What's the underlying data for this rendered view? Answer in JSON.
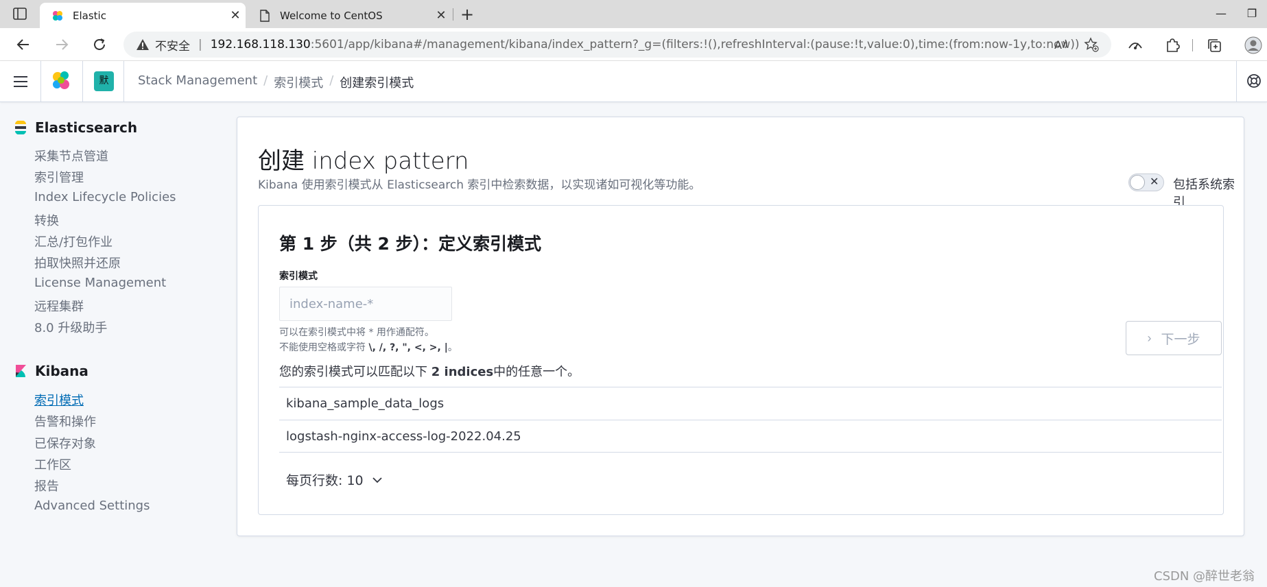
{
  "browser": {
    "tabs": [
      {
        "title": "Elastic",
        "active": true
      },
      {
        "title": "Welcome to CentOS",
        "active": false
      }
    ],
    "tab_close": "✕",
    "new_tab": "+",
    "window": {
      "minimize": "—",
      "maximize": "❐"
    },
    "address": {
      "security_label": "不安全",
      "host": "192.168.118.130",
      "path": ":5601/app/kibana#/management/kibana/index_pattern?_g=(filters:!(),refreshInterval:(pause:!t,value:0),time:(from:now-1y,to:now))"
    }
  },
  "header": {
    "space_badge": "默",
    "breadcrumbs": [
      "Stack Management",
      "索引模式",
      "创建索引模式"
    ]
  },
  "sidenav": {
    "elasticsearch": {
      "title": "Elasticsearch",
      "items": [
        "采集节点管道",
        "索引管理",
        "Index Lifecycle Policies",
        "转换",
        "汇总/打包作业",
        "拍取快照并还原",
        "License Management",
        "远程集群",
        "8.0 升级助手"
      ]
    },
    "kibana": {
      "title": "Kibana",
      "items": [
        "索引模式",
        "告警和操作",
        "已保存对象",
        "工作区",
        "报告",
        "Advanced Settings"
      ],
      "active_index": 0
    }
  },
  "main": {
    "title": "创建 index pattern",
    "description": "Kibana 使用索引模式从 Elasticsearch 索引中检索数据，以实现诸如可视化等功能。",
    "toggle": {
      "label": "包括系统索引",
      "x": "✕"
    },
    "step_title": "第 1 步（共 2 步）：定义索引模式",
    "field_label": "索引模式",
    "field_placeholder": "index-name-*",
    "help_line1": "可以在索引模式中将 * 用作通配符。",
    "help_line2_prefix": "不能使用空格或字符 ",
    "help_line2_chars": "\\, /, ?, \", <, >, |",
    "help_line2_suffix": "。",
    "next_button": "下一步",
    "next_chevron": "›",
    "match_prefix": "您的索引模式可以匹配以下 ",
    "match_count": "2 indices",
    "match_suffix": "中的任意一个。",
    "indices": [
      "kibana_sample_data_logs",
      "logstash-nginx-access-log-2022.04.25"
    ],
    "rows_per_page_label": "每页行数: 10"
  },
  "watermark": "CSDN @醉世老翁"
}
